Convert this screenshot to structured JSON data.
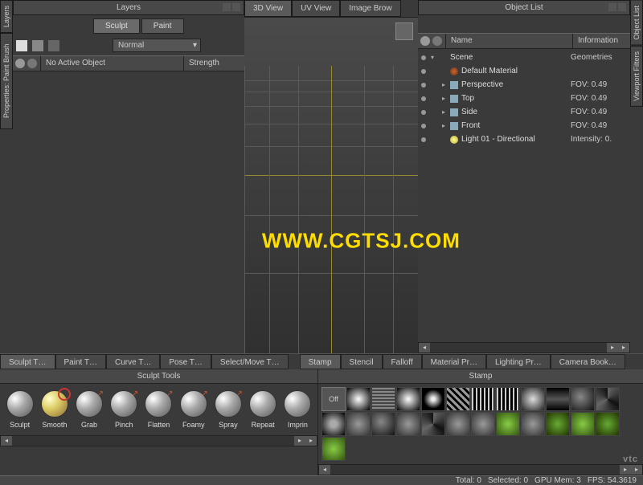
{
  "left_tabs": {
    "layers": "Layers",
    "properties": "Properties: Paint Brush"
  },
  "right_tabs": {
    "object_list": "Object List",
    "viewport_filters": "Viewport Filters"
  },
  "layers_panel": {
    "title": "Layers",
    "modes": {
      "sculpt": "Sculpt",
      "paint": "Paint"
    },
    "blend_mode": "Normal",
    "header_name": "No Active Object",
    "header_strength": "Strength"
  },
  "viewport": {
    "tabs": {
      "view3d": "3D View",
      "uv": "UV View",
      "image": "Image Brow"
    }
  },
  "object_list": {
    "title": "Object List",
    "header_name": "Name",
    "header_info": "Information",
    "items": [
      {
        "label": "Scene",
        "info": "Geometries",
        "indent": 0,
        "expand": "▾",
        "icon": ""
      },
      {
        "label": "Default Material",
        "info": "",
        "indent": 1,
        "expand": "",
        "icon": "mat"
      },
      {
        "label": "Perspective",
        "info": "FOV: 0.49",
        "indent": 1,
        "expand": "▸",
        "icon": "cam"
      },
      {
        "label": "Top",
        "info": "FOV: 0.49",
        "indent": 1,
        "expand": "▸",
        "icon": "cam"
      },
      {
        "label": "Side",
        "info": "FOV: 0.49",
        "indent": 1,
        "expand": "▸",
        "icon": "cam"
      },
      {
        "label": "Front",
        "info": "FOV: 0.49",
        "indent": 1,
        "expand": "▸",
        "icon": "cam"
      },
      {
        "label": "Light 01 - Directional",
        "info": "Intensity: 0.",
        "indent": 1,
        "expand": "",
        "icon": "light"
      }
    ]
  },
  "tool_tabs_left": [
    "Sculpt T…",
    "Paint T…",
    "Curve T…",
    "Pose T…",
    "Select/Move T…"
  ],
  "tool_tabs_right": [
    "Stamp",
    "Stencil",
    "Falloff",
    "Material Pr…",
    "Lighting Pr…",
    "Camera Book…"
  ],
  "sculpt_tools": {
    "title": "Sculpt Tools",
    "items": [
      "Sculpt",
      "Smooth",
      "Grab",
      "Pinch",
      "Flatten",
      "Foamy",
      "Spray",
      "Repeat",
      "Imprin"
    ]
  },
  "stamp_panel": {
    "title": "Stamp",
    "off_label": "Off"
  },
  "status": {
    "total": "Total: 0",
    "selected": "Selected: 0",
    "gpu": "GPU Mem: 3",
    "fps": "FPS: 54.3619"
  },
  "watermark": "WWW.CGTSJ.COM",
  "logo": "vtc"
}
